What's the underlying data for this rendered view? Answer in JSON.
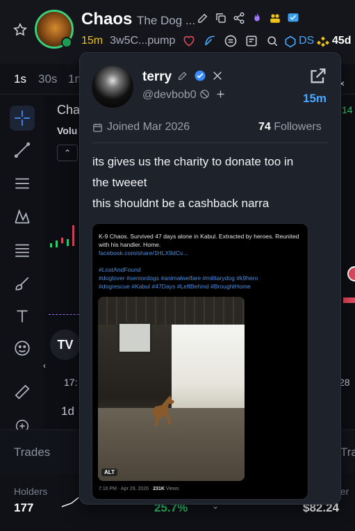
{
  "header": {
    "token_name": "Chaos",
    "token_subtitle": "The Dog ...",
    "age": "15m",
    "address": "3w5C...pump",
    "ds_label": "DS",
    "cap_partial": "45d"
  },
  "timeframes": [
    "1s",
    "30s",
    "1m"
  ],
  "chart": {
    "title": "Cha",
    "volume_label": "Volu",
    "time_left": "17:",
    "time_right": "28",
    "range": "1d",
    "tv_logo": "TV"
  },
  "bottom": {
    "tab_left": "Trades",
    "tab_right": "Tra",
    "stats": [
      {
        "label": "Holders",
        "value": "177"
      },
      {
        "label": "",
        "value": "25.7%"
      },
      {
        "label": "der",
        "value": "$82.24"
      }
    ]
  },
  "profile_card": {
    "name": "terry",
    "handle": "@devbob0",
    "age": "15m",
    "joined": "Joined Mar 2026",
    "followers_count": "74",
    "followers_label": "Followers",
    "tweet_lines": [
      "its gives us the charity to donate too in",
      "the tweeet",
      "this shouldnt be a cashback narra"
    ],
    "embed": {
      "text": "K-9 Chaos. Survived 47 days alone in Kabul. Extracted by heroes. Reunited with his handler. Home.",
      "link": "facebook.com/share/1HLX9dCv...",
      "hashtags_1": "#LostAndFound",
      "hashtags_2": "#doglover #seniordogs #animalwelfare #militarydog #k9hero",
      "hashtags_3": "#dogrescue #Kabul #47Days #LeftBehind #BroughtHome",
      "alt": "ALT",
      "meta_time": "7:16 PM · Apr 29, 2026 · ",
      "meta_views": "231K",
      "meta_views_label": " Views"
    }
  },
  "colors": {
    "accent_yellow": "#f0c419",
    "accent_blue": "#4aa8ff",
    "green": "#2ecc71",
    "card_bg": "#1d222b"
  }
}
